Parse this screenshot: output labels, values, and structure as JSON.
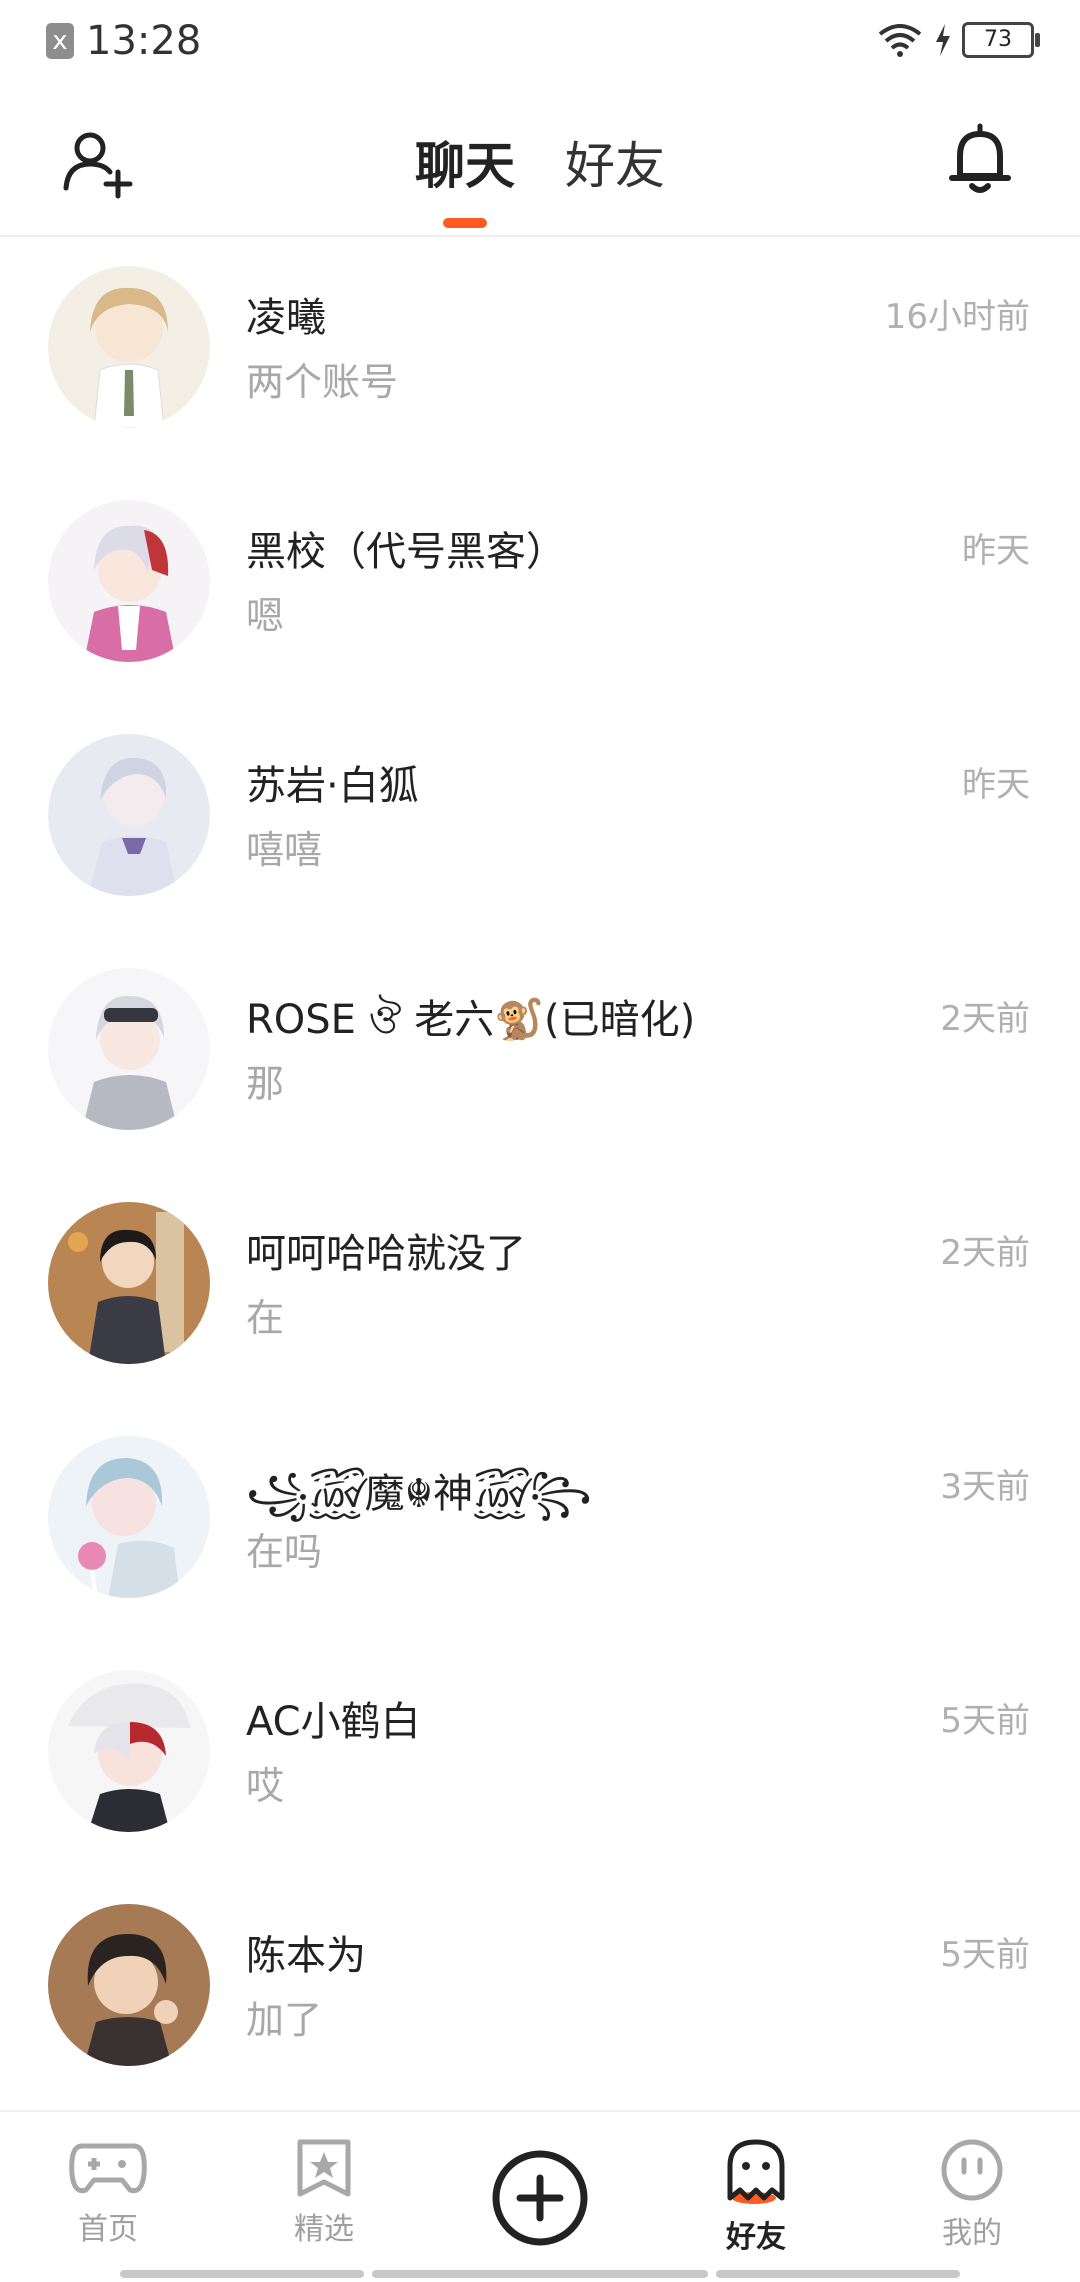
{
  "status_bar": {
    "time": "13:28",
    "battery": "73",
    "sim_icon": "x"
  },
  "header": {
    "tabs": [
      {
        "label": "聊天",
        "active": true
      },
      {
        "label": "好友",
        "active": false
      }
    ],
    "icons": {
      "left": "add-friend-icon",
      "right": "bell-icon"
    },
    "accent_color": "#ff5a1f"
  },
  "chats": [
    {
      "name": "凌曦",
      "message": "两个账号",
      "time": "16小时前"
    },
    {
      "name": "黑校（代号黑客）",
      "message": "嗯",
      "time": "昨天"
    },
    {
      "name": "苏岩·白狐",
      "message": "嘻嘻",
      "time": "昨天"
    },
    {
      "name": "ROSE ঔ 老六🐒(已暗化)",
      "message": "那",
      "time": "2天前"
    },
    {
      "name": "呵呵哈哈就没了",
      "message": "在",
      "time": "2天前"
    },
    {
      "name": "꧁꫞魔☬神꫞꧂",
      "message": "在吗",
      "time": "3天前"
    },
    {
      "name": "AC小鹤白",
      "message": "哎",
      "time": "5天前"
    },
    {
      "name": "陈本为",
      "message": "加了",
      "time": "5天前"
    }
  ],
  "bottom_nav": [
    {
      "label": "首页",
      "icon": "gamepad-icon",
      "active": false
    },
    {
      "label": "精选",
      "icon": "star-bookmark-icon",
      "active": false
    },
    {
      "label": "",
      "icon": "plus-circle-icon",
      "active": false
    },
    {
      "label": "好友",
      "icon": "ghost-icon",
      "active": true
    },
    {
      "label": "我的",
      "icon": "face-icon",
      "active": false
    }
  ]
}
